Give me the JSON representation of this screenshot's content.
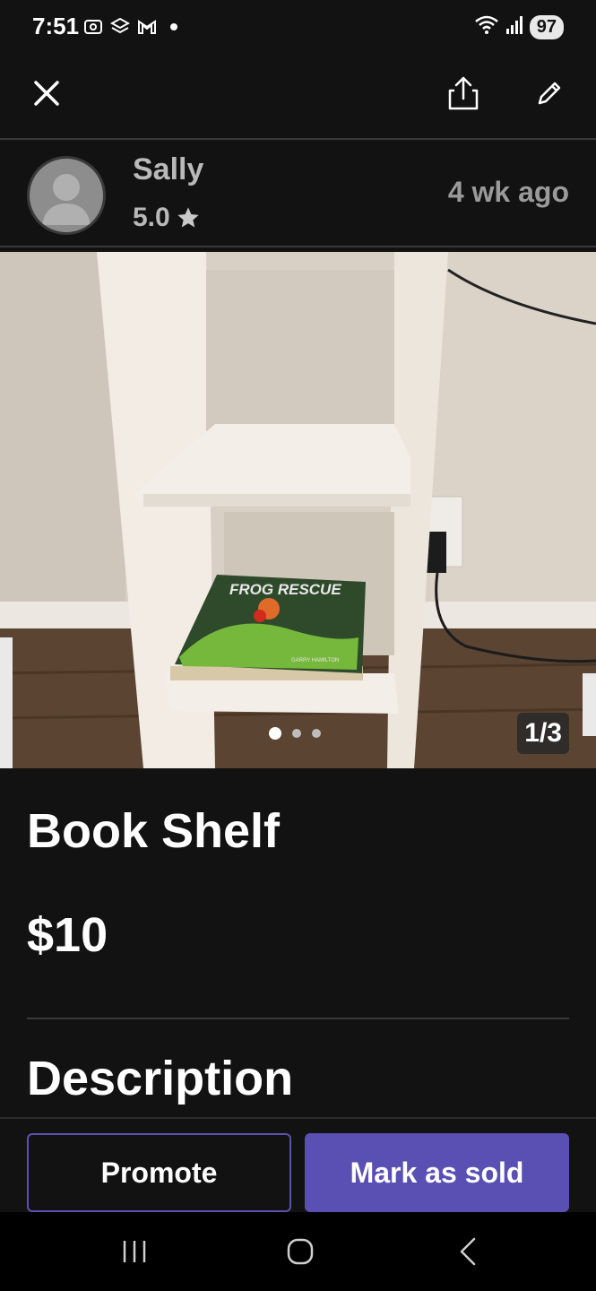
{
  "status_bar": {
    "time": "7:51",
    "battery": "97"
  },
  "top_bar": {
    "close_icon": "close-icon",
    "share_icon": "share-icon",
    "edit_icon": "pencil-icon"
  },
  "seller": {
    "name": "Sally",
    "rating": "5.0",
    "posted": "4 wk  ago"
  },
  "photo": {
    "counter": "1/3",
    "current_index": 1,
    "total": 3,
    "book_title": "FROG RESCUE",
    "book_author": "GARRY HAMILTON"
  },
  "listing": {
    "title": "Book Shelf",
    "price": "$10",
    "section_title": "Description"
  },
  "actions": {
    "promote_label": "Promote",
    "mark_sold_label": "Mark as sold"
  },
  "colors": {
    "background": "#121212",
    "accent": "#5a4fb3",
    "text_muted": "#b9b9b9"
  }
}
